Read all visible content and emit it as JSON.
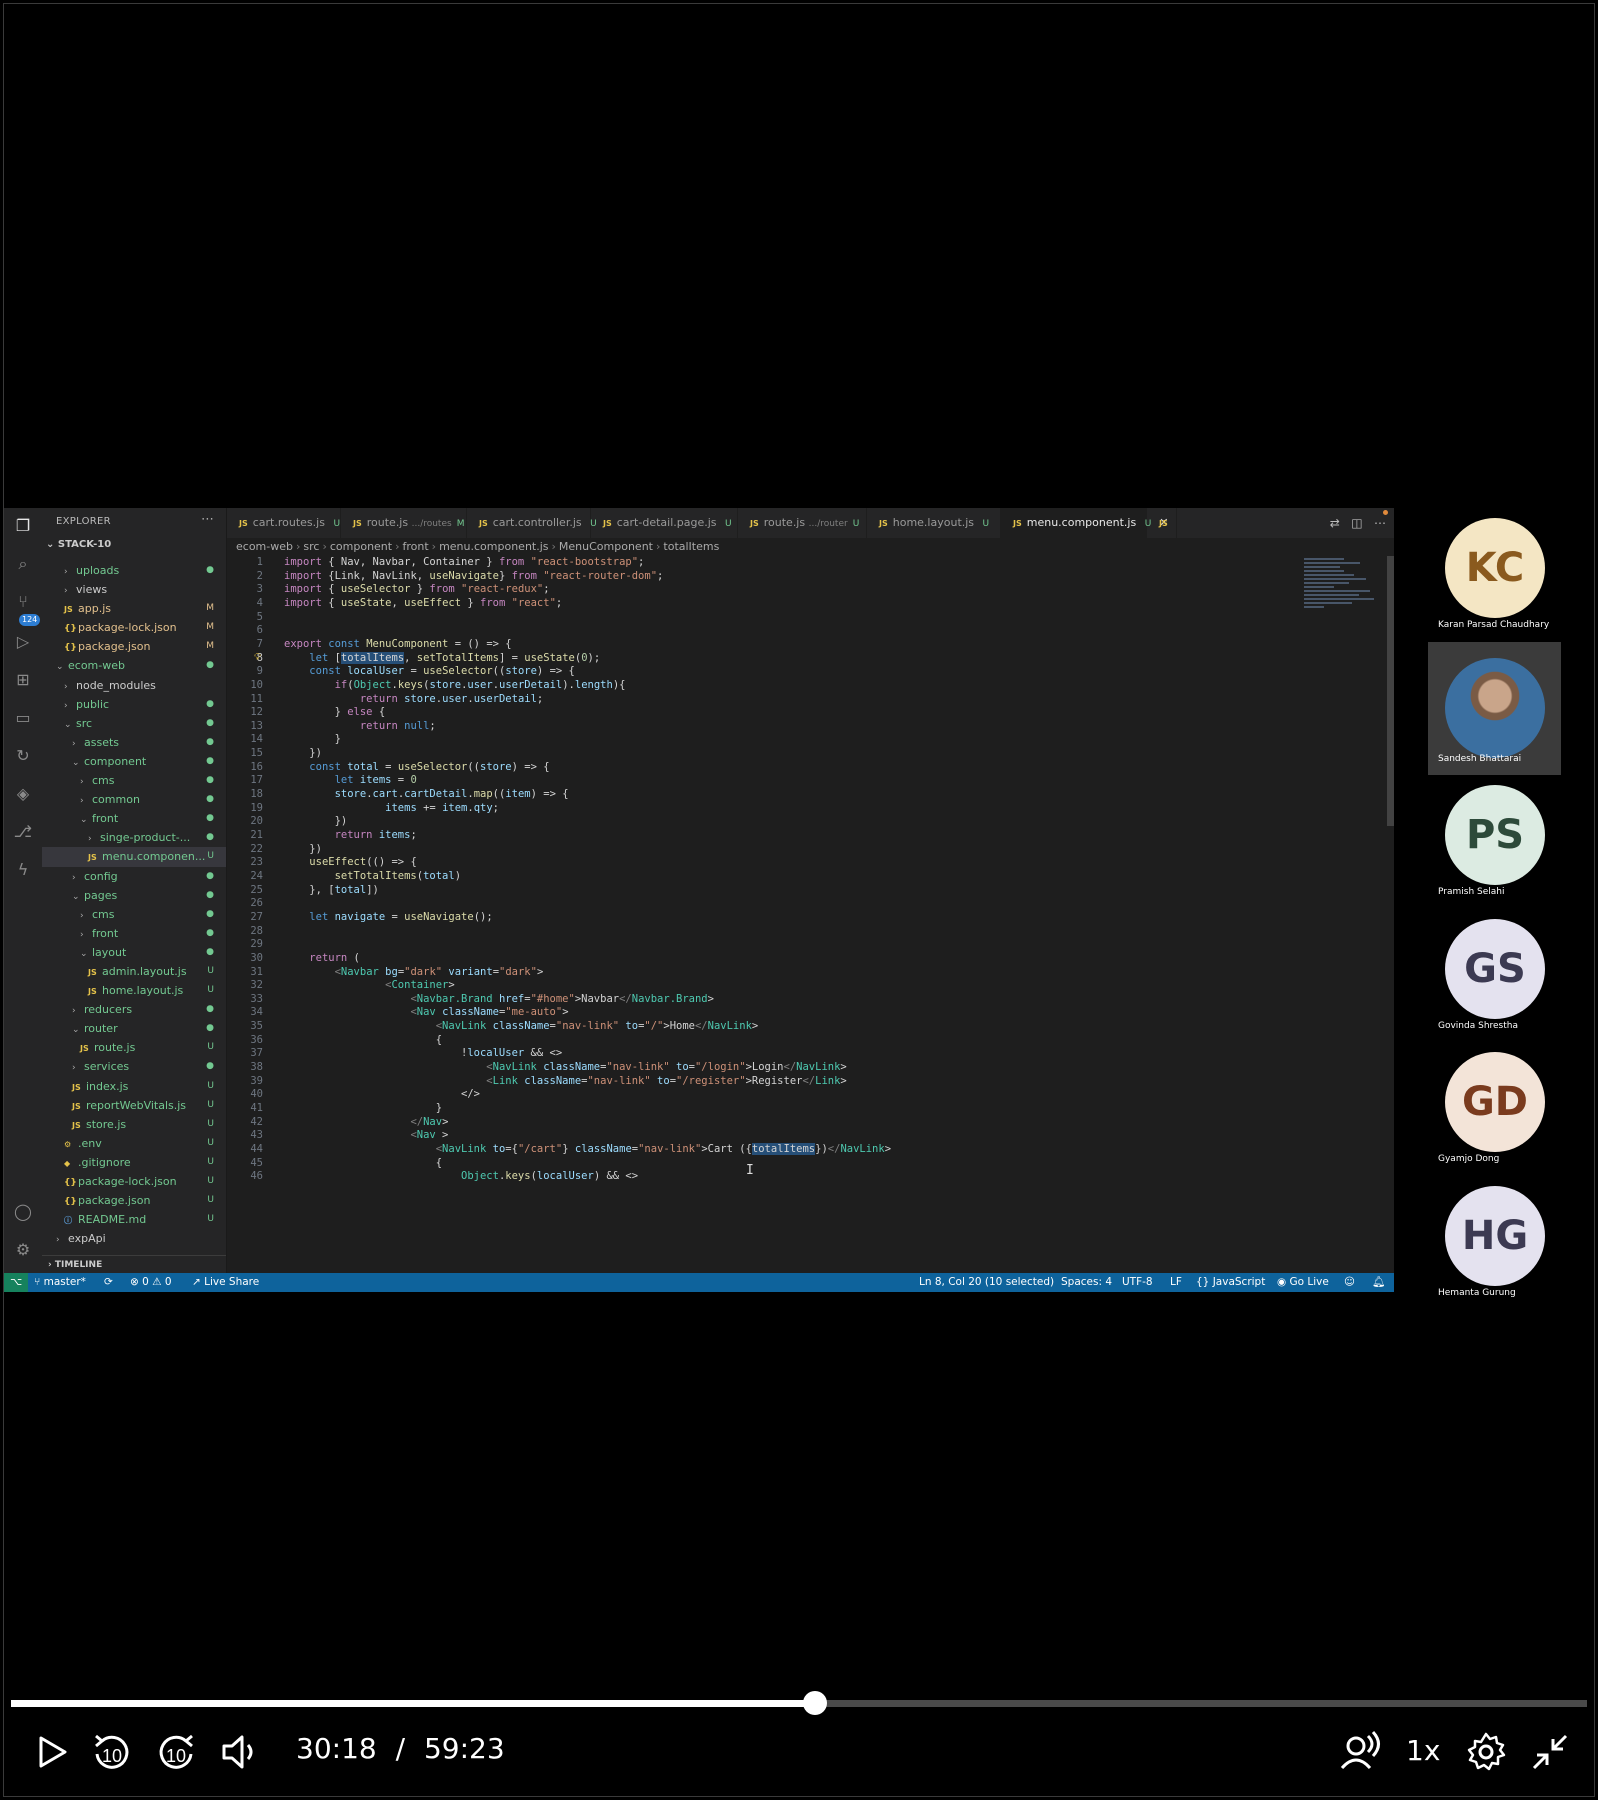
{
  "explorer": {
    "title": "EXPLORER",
    "section": "STACK-10",
    "timeline": "TIMELINE",
    "badge": "124",
    "items": [
      {
        "label": "uploads",
        "kind": "folder",
        "open": false,
        "depth": 1,
        "status": "●"
      },
      {
        "label": "views",
        "kind": "folder",
        "open": false,
        "depth": 1,
        "status": ""
      },
      {
        "label": "app.js",
        "kind": "js",
        "depth": 1,
        "status": "M"
      },
      {
        "label": "package-lock.json",
        "kind": "json",
        "depth": 1,
        "status": "M"
      },
      {
        "label": "package.json",
        "kind": "json",
        "depth": 1,
        "status": "M"
      },
      {
        "label": "ecom-web",
        "kind": "folder",
        "open": true,
        "depth": 0,
        "status": "●"
      },
      {
        "label": "node_modules",
        "kind": "folder",
        "open": false,
        "depth": 1,
        "status": ""
      },
      {
        "label": "public",
        "kind": "folder",
        "open": false,
        "depth": 1,
        "status": "●"
      },
      {
        "label": "src",
        "kind": "folder",
        "open": true,
        "depth": 1,
        "status": "●"
      },
      {
        "label": "assets",
        "kind": "folder",
        "open": false,
        "depth": 2,
        "status": "●"
      },
      {
        "label": "component",
        "kind": "folder",
        "open": true,
        "depth": 2,
        "status": "●"
      },
      {
        "label": "cms",
        "kind": "folder",
        "open": false,
        "depth": 3,
        "status": "●"
      },
      {
        "label": "common",
        "kind": "folder",
        "open": false,
        "depth": 3,
        "status": "●"
      },
      {
        "label": "front",
        "kind": "folder",
        "open": true,
        "depth": 3,
        "status": "●"
      },
      {
        "label": "singe-product-...",
        "kind": "folder",
        "open": false,
        "depth": 4,
        "status": "●"
      },
      {
        "label": "menu.componen...",
        "kind": "js",
        "depth": 4,
        "status": "U",
        "selected": true
      },
      {
        "label": "config",
        "kind": "folder",
        "open": false,
        "depth": 2,
        "status": "●"
      },
      {
        "label": "pages",
        "kind": "folder",
        "open": true,
        "depth": 2,
        "status": "●"
      },
      {
        "label": "cms",
        "kind": "folder",
        "open": false,
        "depth": 3,
        "status": "●"
      },
      {
        "label": "front",
        "kind": "folder",
        "open": false,
        "depth": 3,
        "status": "●"
      },
      {
        "label": "layout",
        "kind": "folder",
        "open": true,
        "depth": 3,
        "status": "●"
      },
      {
        "label": "admin.layout.js",
        "kind": "js",
        "depth": 4,
        "status": "U"
      },
      {
        "label": "home.layout.js",
        "kind": "js",
        "depth": 4,
        "status": "U"
      },
      {
        "label": "reducers",
        "kind": "folder",
        "open": false,
        "depth": 2,
        "status": "●"
      },
      {
        "label": "router",
        "kind": "folder",
        "open": true,
        "depth": 2,
        "status": "●"
      },
      {
        "label": "route.js",
        "kind": "js",
        "depth": 3,
        "status": "U"
      },
      {
        "label": "services",
        "kind": "folder",
        "open": false,
        "depth": 2,
        "status": "●"
      },
      {
        "label": "index.js",
        "kind": "js",
        "depth": 2,
        "status": "U"
      },
      {
        "label": "reportWebVitals.js",
        "kind": "js",
        "depth": 2,
        "status": "U"
      },
      {
        "label": "store.js",
        "kind": "js",
        "depth": 2,
        "status": "U"
      },
      {
        "label": ".env",
        "kind": "gear",
        "depth": 1,
        "status": "U"
      },
      {
        "label": ".gitignore",
        "kind": "diamond",
        "depth": 1,
        "status": "U"
      },
      {
        "label": "package-lock.json",
        "kind": "json",
        "depth": 1,
        "status": "U"
      },
      {
        "label": "package.json",
        "kind": "json",
        "depth": 1,
        "status": "U"
      },
      {
        "label": "README.md",
        "kind": "info",
        "depth": 1,
        "status": "U"
      },
      {
        "label": "expApi",
        "kind": "folder",
        "open": false,
        "depth": 0,
        "status": ""
      }
    ]
  },
  "tabs": [
    {
      "label": "cart.routes.js",
      "path": "",
      "status": "U",
      "active": false
    },
    {
      "label": "route.js",
      "path": ".../routes",
      "status": "M",
      "active": false
    },
    {
      "label": "cart.controller.js",
      "path": "",
      "status": "U",
      "active": false
    },
    {
      "label": "cart-detail.page.js",
      "path": "",
      "status": "U",
      "active": false
    },
    {
      "label": "route.js",
      "path": ".../router",
      "status": "U",
      "active": false
    },
    {
      "label": "home.layout.js",
      "path": "",
      "status": "U",
      "active": false
    },
    {
      "label": "menu.component.js",
      "path": "",
      "status": "U",
      "active": true
    },
    {
      "label": "JS",
      "path": "",
      "status": "",
      "active": false
    }
  ],
  "breadcrumb": [
    "ecom-web",
    "src",
    "component",
    "front",
    "menu.component.js",
    "MenuComponent",
    "totalItems"
  ],
  "editor": {
    "current_line": 8,
    "lines": [
      "import { Nav, Navbar, Container } from \"react-bootstrap\";",
      "import {Link, NavLink, useNavigate} from \"react-router-dom\";",
      "import { useSelector } from \"react-redux\";",
      "import { useState, useEffect } from \"react\";",
      "",
      "",
      "export const MenuComponent = () => {",
      "    let [totalItems, setTotalItems] = useState(0);",
      "    const localUser = useSelector((store) => {",
      "        if(Object.keys(store.user.userDetail).length){",
      "            return store.user.userDetail;",
      "        } else {",
      "            return null;",
      "        }",
      "    })",
      "    const total = useSelector((store) => {",
      "        let items = 0",
      "        store.cart.cartDetail.map((item) => {",
      "                items += item.qty;",
      "        })",
      "        return items;",
      "    })",
      "    useEffect(() => {",
      "        setTotalItems(total)",
      "    }, [total])",
      "",
      "    let navigate = useNavigate();",
      "",
      "",
      "    return (",
      "        <Navbar bg=\"dark\" variant=\"dark\">",
      "                <Container>",
      "                    <Navbar.Brand href=\"#home\">Navbar</Navbar.Brand>",
      "                    <Nav className=\"me-auto\">",
      "                        <NavLink className=\"nav-link\" to=\"/\">Home</NavLink>",
      "                        {",
      "                            !localUser && <>",
      "                                <NavLink className=\"nav-link\" to=\"/login\">Login</NavLink>",
      "                                <Link className=\"nav-link\" to=\"/register\">Register</Link>",
      "                            </>",
      "                        }",
      "                    </Nav>",
      "                    <Nav >",
      "                        <NavLink to={\"/cart\"} className=\"nav-link\">Cart ({totalItems})</NavLink>",
      "                        {",
      "                            Object.keys(localUser) && <>"
    ]
  },
  "statusbar": {
    "branch": "master*",
    "problems": "⊗ 0 ⚠ 0",
    "liveshare": "Live Share",
    "position": "Ln 8, Col 20 (10 selected)",
    "spaces": "Spaces: 4",
    "encoding": "UTF-8",
    "eol": "LF",
    "language": "JavaScript",
    "golive": "Go Live"
  },
  "participants": [
    {
      "initials": "KC",
      "name": "Karan Parsad Chaudhary",
      "color": "#f4e6c4",
      "text": "#8a5a1e",
      "photo": false
    },
    {
      "initials": "",
      "name": "Sandesh Bhattarai",
      "color": "",
      "text": "",
      "photo": true
    },
    {
      "initials": "PS",
      "name": "Pramish Selahi",
      "color": "#dcebe2",
      "text": "#2d4a3a",
      "photo": false
    },
    {
      "initials": "GS",
      "name": "Govinda Shrestha",
      "color": "#e4e2ef",
      "text": "#3c3a52",
      "photo": false
    },
    {
      "initials": "GD",
      "name": "Gyamjo Dong",
      "color": "#f3e4d8",
      "text": "#7a3b1e",
      "photo": false
    },
    {
      "initials": "HG",
      "name": "Hemanta Gurung",
      "color": "#e4e2ef",
      "text": "#3c3a52",
      "photo": false
    }
  ],
  "player": {
    "current_time": "30:18",
    "separator": "/",
    "duration": "59:23",
    "progress": 0.51,
    "speed": "1x",
    "skip_seconds": "10"
  }
}
